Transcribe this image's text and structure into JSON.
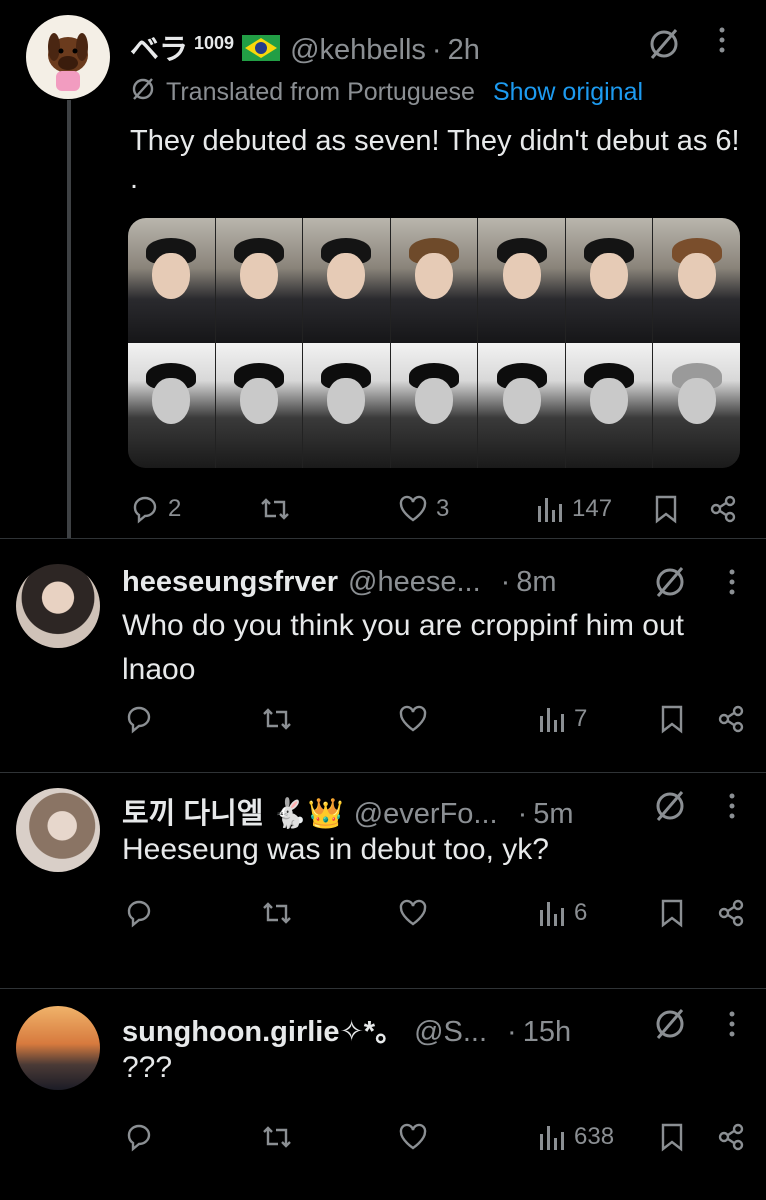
{
  "posts": [
    {
      "display_name": "ベラ",
      "sup_number": "1009",
      "flag": "🇧🇷",
      "handle": "@kehbells",
      "time": "2h",
      "translated_label": "Translated from Portuguese",
      "show_original": "Show original",
      "text": "They debuted as seven! They didn't debut as 6! .",
      "stats": {
        "replies": "2",
        "reposts": "",
        "likes": "3",
        "views": "147"
      }
    },
    {
      "display_name": "heeseungsfrver",
      "handle": "@heese...",
      "time": "8m",
      "text": "Who do you think you are croppinf him out lnaoo",
      "stats": {
        "replies": "",
        "reposts": "",
        "likes": "",
        "views": "7"
      }
    },
    {
      "display_name": "토끼 다니엘 🐇👑",
      "handle": "@everFo...",
      "time": "5m",
      "text": "Heeseung was in debut too, yk?",
      "stats": {
        "replies": "",
        "reposts": "",
        "likes": "",
        "views": "6"
      }
    },
    {
      "display_name": "sunghoon.girlie✧*。",
      "handle": "@S...",
      "time": "15h",
      "text": "???",
      "stats": {
        "replies": "",
        "reposts": "",
        "likes": "",
        "views": "638"
      }
    }
  ],
  "icons": {
    "no_translate": "translate-off-icon",
    "more": "more-vertical-icon",
    "reply": "reply-icon",
    "repost": "repost-icon",
    "like": "heart-icon",
    "views": "views-icon",
    "bookmark": "bookmark-icon",
    "share": "share-icon"
  },
  "colors": {
    "background": "#000000",
    "text": "#e7e9ea",
    "muted": "#8b8f93",
    "link": "#1d9bf0",
    "divider": "#2f3336"
  }
}
